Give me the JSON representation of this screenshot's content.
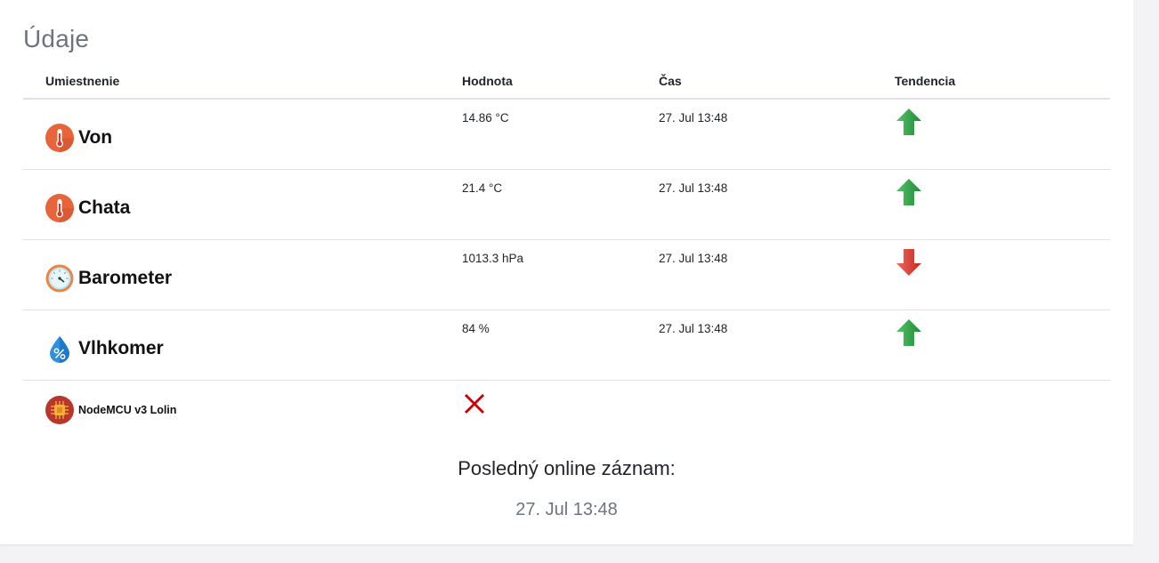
{
  "card": {
    "title": "Údaje"
  },
  "table": {
    "headers": {
      "location": "Umiestnenie",
      "value": "Hodnota",
      "time": "Čas",
      "trend": "Tendencia"
    },
    "rows": [
      {
        "name": "Von",
        "icon": "thermometer-icon",
        "value": "14.86 °C",
        "time": "27. Jul 13:48",
        "trend": "up"
      },
      {
        "name": "Chata",
        "icon": "thermometer-icon",
        "value": "21.4 °C",
        "time": "27. Jul 13:48",
        "trend": "up"
      },
      {
        "name": "Barometer",
        "icon": "barometer-gauge-icon",
        "value": "1013.3 hPa",
        "time": "27. Jul 13:48",
        "trend": "down"
      },
      {
        "name": "Vlhkomer",
        "icon": "humidity-drop-icon",
        "value": "84 %",
        "time": "27. Jul 13:48",
        "trend": "up"
      }
    ],
    "device": {
      "name": "NodeMCU v3 Lolin",
      "icon": "chip-icon",
      "status": "offline"
    }
  },
  "footer": {
    "last_online_label": "Posledný online záznam:",
    "last_online_time": "27. Jul 13:48"
  },
  "colors": {
    "trend_up": "#2ea043",
    "trend_down": "#d9342b",
    "offline_x": "#cc0000",
    "title_gray": "#6c757d"
  }
}
